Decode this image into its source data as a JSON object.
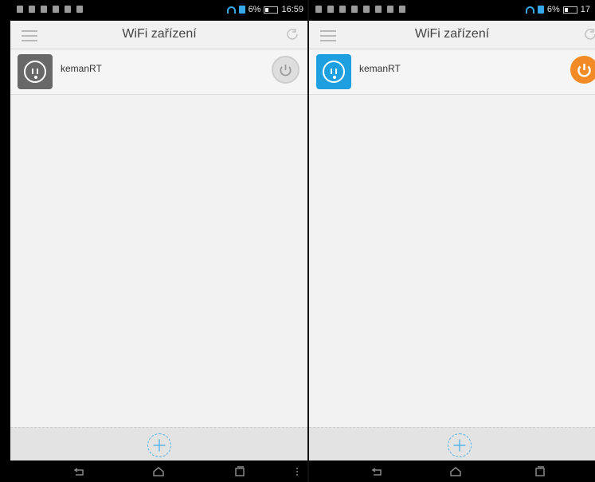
{
  "app": {
    "title": "WiFi zařízení",
    "menu_icon": "hamburger-menu-icon",
    "refresh_icon": "refresh-icon"
  },
  "status_bar": {
    "left": {
      "signal": "6%",
      "time": "16:59"
    },
    "right": {
      "signal": "6%",
      "time": "17"
    }
  },
  "device": {
    "name": "kemanRT",
    "icon": "power-outlet-icon"
  },
  "actions": {
    "add_icon": "add-circle-icon"
  },
  "nav": {
    "back_icon": "back-icon",
    "home_icon": "home-icon",
    "recent_icon": "recent-apps-icon",
    "more_icon": "more-vertical-icon"
  },
  "colors": {
    "power_on": "#f28a26",
    "power_off": "#dedede",
    "device_active": "#1e9fe0",
    "device_inactive": "#686868",
    "accent": "#37a7e8"
  }
}
